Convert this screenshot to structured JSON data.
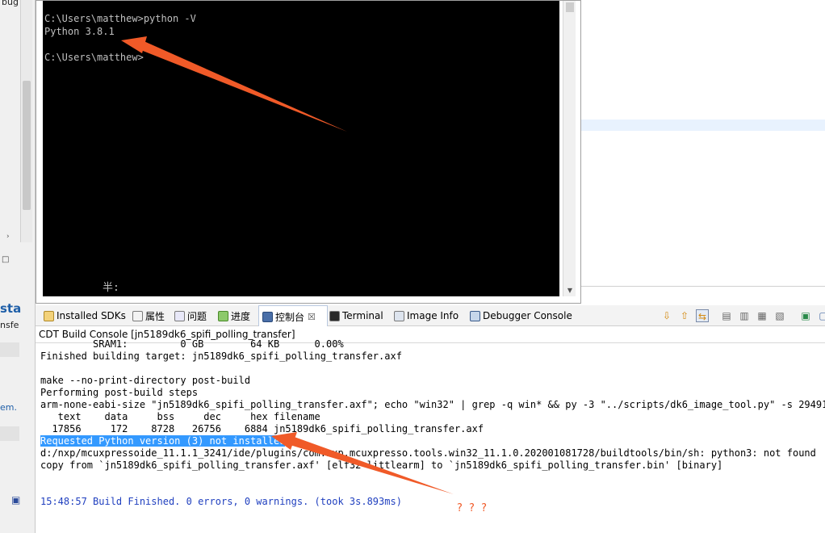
{
  "left_strip": {
    "items": [
      "bug",
      "sta",
      "nsfe",
      "em."
    ]
  },
  "terminal": {
    "lines": [
      "C:\\Users\\matthew>python -V",
      "Python 3.8.1",
      "",
      "C:\\Users\\matthew>"
    ],
    "ime_indicator": "半:"
  },
  "tabs": {
    "items": [
      {
        "label": "Installed SDKs",
        "icon": "installed-sdks-icon"
      },
      {
        "label": "属性",
        "icon": "properties-icon"
      },
      {
        "label": "问题",
        "icon": "problems-icon"
      },
      {
        "label": "进度",
        "icon": "progress-icon"
      },
      {
        "label": "控制台",
        "icon": "console-icon",
        "active": true,
        "close": "☒"
      },
      {
        "label": "Terminal",
        "icon": "terminal-icon"
      },
      {
        "label": "Image Info",
        "icon": "image-info-icon"
      },
      {
        "label": "Debugger Console",
        "icon": "debugger-console-icon"
      }
    ]
  },
  "console": {
    "title": "CDT Build Console [jn5189dk6_spifi_polling_transfer]",
    "lines": [
      "         SRAM1:         0 GB        64 KB      0.00%",
      "Finished building target: jn5189dk6_spifi_polling_transfer.axf",
      "",
      "make --no-print-directory post-build",
      "Performing post-build steps",
      "arm-none-eabi-size \"jn5189dk6_spifi_polling_transfer.axf\"; echo \"win32\" | grep -q win* && py -3 \"../scripts/dk6_image_tool.py\" -s 294912  j",
      "   text    data     bss     dec     hex filename",
      "  17856     172    8728   26756    6884 jn5189dk6_spifi_polling_transfer.axf",
      "Requested Python version (3) not installed",
      "d:/nxp/mcuxpressoide_11.1.1_3241/ide/plugins/com.nxp.mcuxpresso.tools.win32_11.1.0.202001081728/buildtools/bin/sh: python3: not found",
      "copy from `jn5189dk6_spifi_polling_transfer.axf' [elf32-littlearm] to `jn5189dk6_spifi_polling_transfer.bin' [binary]",
      "",
      "",
      "15:48:57 Build Finished. 0 errors, 0 warnings. (took 3s.893ms)"
    ],
    "selected_line_index": 8,
    "finished_line_index": 13
  },
  "annotation": {
    "question_marks": "? ? ?",
    "arrow_color": "#f05a28"
  }
}
